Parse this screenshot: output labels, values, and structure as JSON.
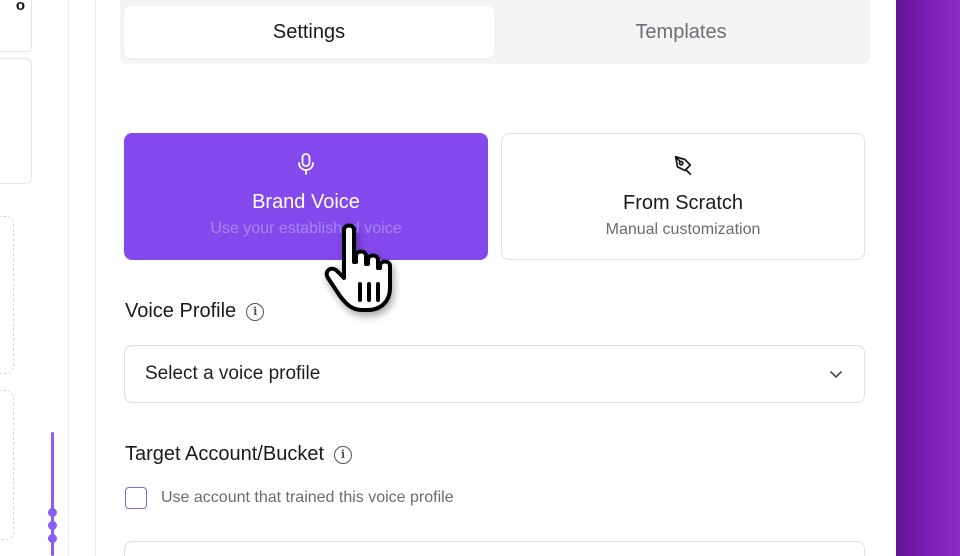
{
  "tabs": [
    {
      "label": "Settings",
      "active": true
    },
    {
      "label": "Templates",
      "active": false
    }
  ],
  "modes": {
    "brand": {
      "title": "Brand Voice",
      "subtitle": "Use your established voice",
      "icon": "microphone-icon",
      "selected": true
    },
    "scratch": {
      "title": "From Scratch",
      "subtitle": "Manual customization",
      "icon": "pen-tool-icon",
      "selected": false
    }
  },
  "voice_profile": {
    "label": "Voice Profile",
    "select_value": "Select a voice profile"
  },
  "target_account": {
    "label": "Target Account/Bucket",
    "checkbox_label": "Use account that trained this voice profile",
    "checkbox_checked": false
  },
  "left_sidebar": {
    "top_glyph": "o"
  },
  "colors": {
    "accent": "#8449ec",
    "right_gradient": "#7a1fb5",
    "timeline": "#8b5cf6"
  }
}
